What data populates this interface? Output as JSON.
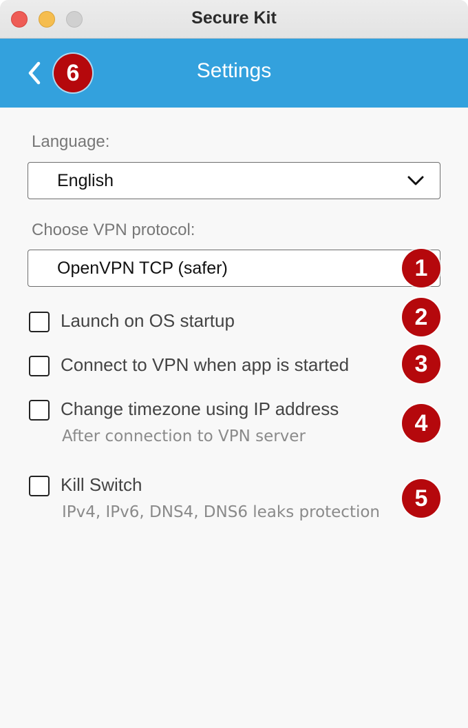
{
  "window": {
    "title": "Secure Kit"
  },
  "header": {
    "title": "Settings",
    "back_icon": "chevron-left-icon"
  },
  "language": {
    "label": "Language:",
    "selected": "English"
  },
  "protocol": {
    "label": "Choose VPN protocol:",
    "selected": "OpenVPN TCP (safer)"
  },
  "options": [
    {
      "label": "Launch on OS startup",
      "checked": false
    },
    {
      "label": "Connect to VPN when app is started",
      "checked": false
    },
    {
      "label": "Change timezone using IP address",
      "sublabel": "After connection to VPN server",
      "checked": false
    },
    {
      "label": "Kill Switch",
      "sublabel": "IPv4, IPv6, DNS4, DNS6 leaks protection",
      "checked": false
    }
  ],
  "badges": {
    "protocol": "1",
    "startup": "2",
    "connect": "3",
    "timezone": "4",
    "killswitch": "5",
    "back": "6"
  },
  "colors": {
    "header": "#33a1dd",
    "badge": "#b5080c",
    "close": "#ee5c56",
    "minimize": "#f5bd4f"
  }
}
